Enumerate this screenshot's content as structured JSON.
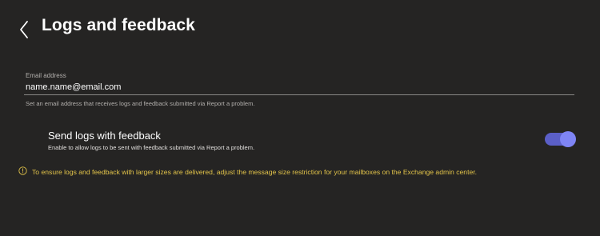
{
  "header": {
    "title": "Logs and feedback",
    "back_icon": "chevron-left-icon"
  },
  "email": {
    "label": "Email address",
    "value": "name.name@email.com",
    "help": "Set an email address that receives logs and feedback submitted via Report a problem."
  },
  "send_logs": {
    "title": "Send logs with feedback",
    "description": "Enable to allow logs to be sent with feedback submitted via Report a problem.",
    "enabled": true
  },
  "notice": {
    "icon": "info-icon",
    "text": "To ensure logs and feedback with larger sizes are delivered, adjust the message size restriction for your mailboxes on the Exchange admin center."
  },
  "colors": {
    "background": "#252423",
    "toggle_track": "#5b5fc7",
    "toggle_thumb": "#7f85f5",
    "notice": "#e3c44a"
  }
}
